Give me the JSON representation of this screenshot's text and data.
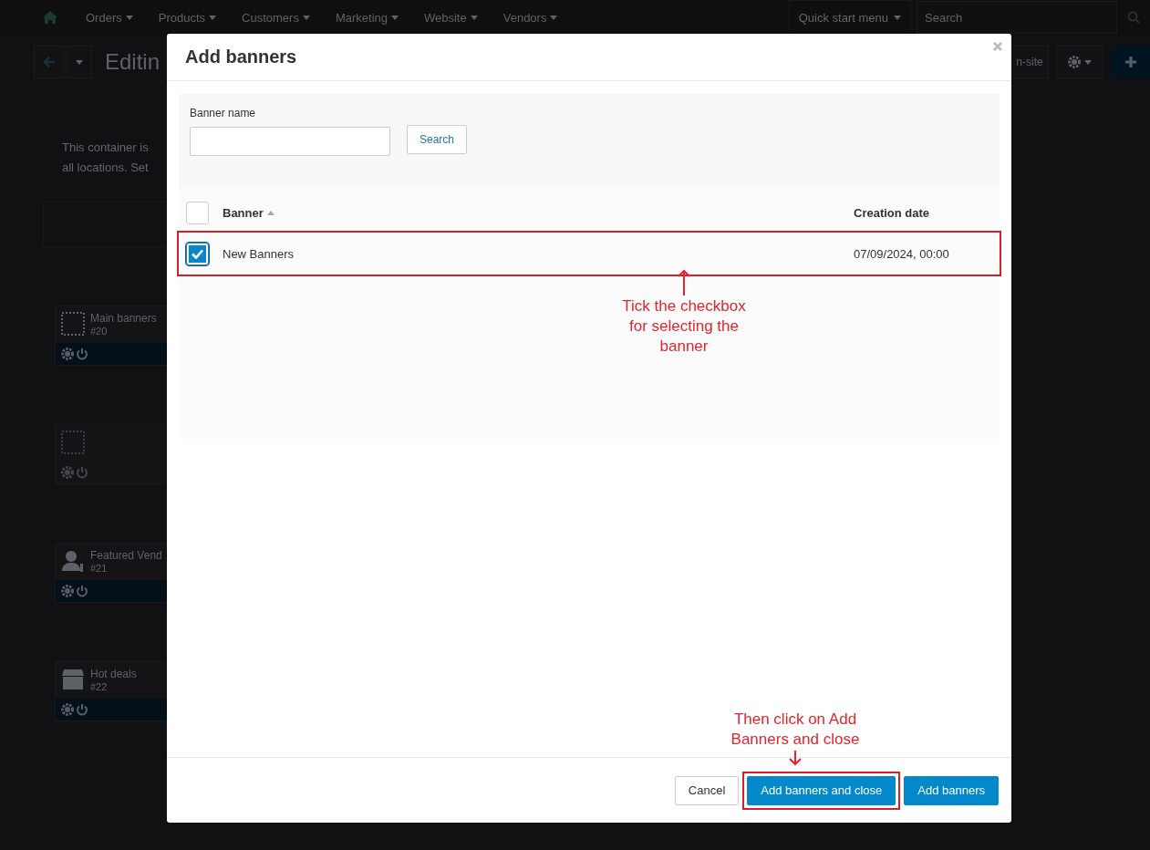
{
  "topbar": {
    "menu": [
      {
        "label": "Orders"
      },
      {
        "label": "Products"
      },
      {
        "label": "Customers"
      },
      {
        "label": "Marketing"
      },
      {
        "label": "Website"
      },
      {
        "label": "Vendors"
      }
    ],
    "quick_start": "Quick start menu",
    "search": {
      "placeholder": "Search"
    }
  },
  "toolbar": {
    "title": "Editin",
    "preview_button": "n-site"
  },
  "notice": [
    "This container is",
    "all locations. Set"
  ],
  "blocks": [
    {
      "kind": "dotted",
      "name": "Main banners",
      "id": "#20",
      "disabled": false
    },
    {
      "kind": "dotted",
      "disabled": true
    },
    {
      "kind": "person",
      "name": "Featured Vend",
      "id": "#21",
      "disabled": false
    },
    {
      "kind": "box",
      "name": "Hot deals",
      "id": "#22",
      "disabled": false
    }
  ],
  "dialog": {
    "title": "Add banners",
    "filter": {
      "label": "Banner name",
      "search_button": "Search"
    },
    "table": {
      "all_checked": false,
      "columns": [
        {
          "label": "Banner",
          "sort_ascending": true
        },
        {
          "label": "Creation date"
        }
      ],
      "rows": [
        {
          "checked": true,
          "highlighted": true,
          "name": "New Banners",
          "date": "07/09/2024, 00:00"
        }
      ]
    },
    "buttons": [
      {
        "label": "Cancel",
        "kind": "default",
        "highlighted": false
      },
      {
        "label": "Add banners and close",
        "kind": "primary",
        "highlighted": true
      },
      {
        "label": "Add banners",
        "kind": "primary",
        "highlighted": false
      }
    ],
    "annotations": [
      {
        "text": "Tick the checkbox\nfor selecting the\nbanner",
        "kind": "arrow-above"
      },
      {
        "text": "Then click on Add\nBanners and close",
        "kind": "arrow-below"
      }
    ]
  }
}
